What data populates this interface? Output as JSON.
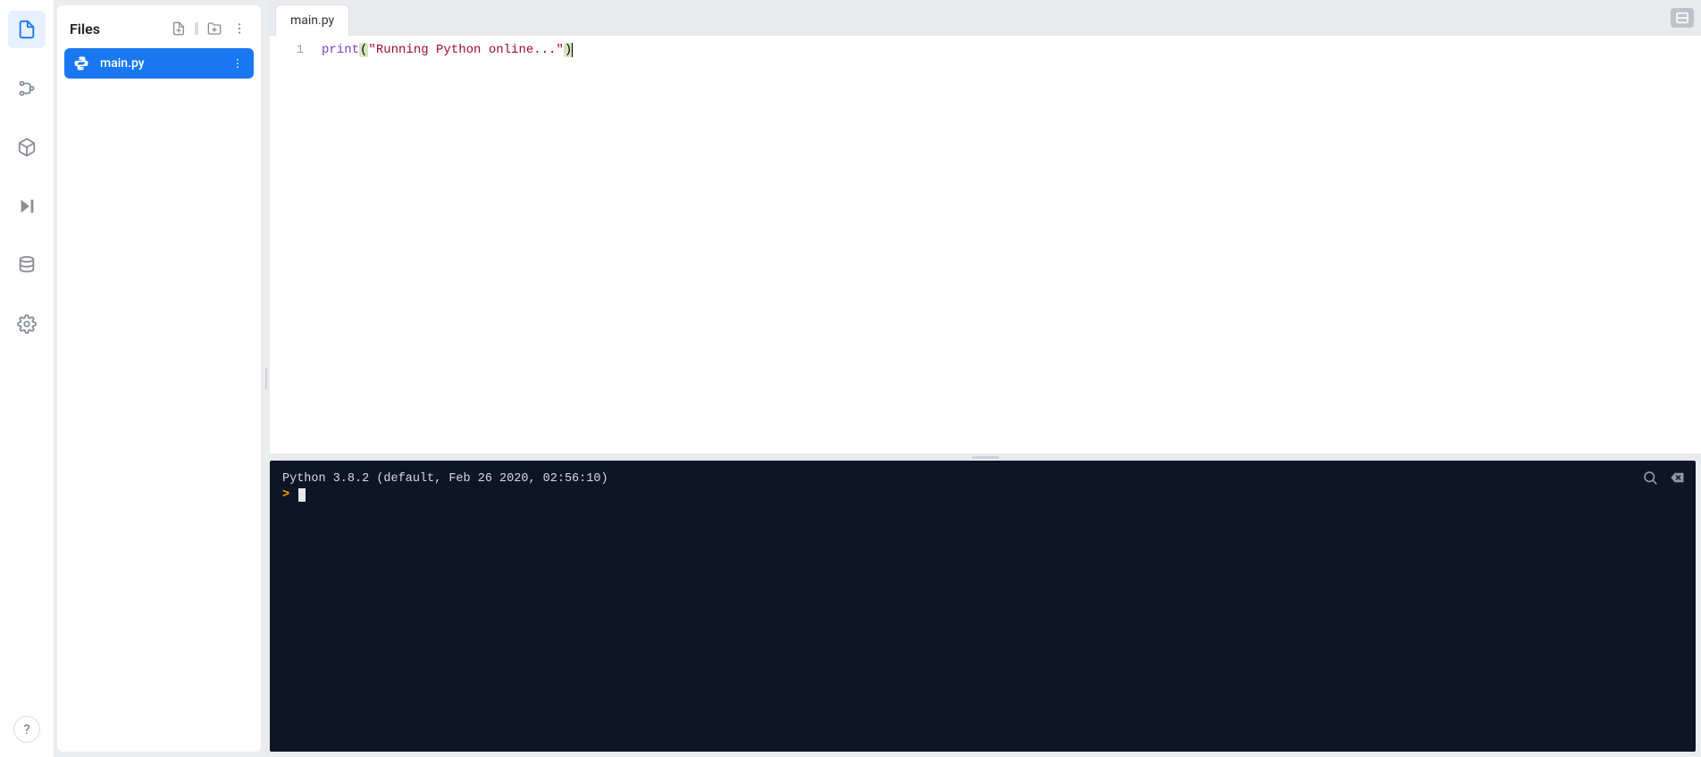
{
  "sidebar": {
    "panel_title": "Files",
    "help_label": "?"
  },
  "files": {
    "items": [
      {
        "name": "main.py"
      }
    ]
  },
  "tabs": {
    "open": [
      {
        "label": "main.py"
      }
    ]
  },
  "editor": {
    "line_numbers": [
      "1"
    ],
    "tokens": {
      "builtin": "print",
      "open_paren": "(",
      "string": "\"Running Python online...\"",
      "close_paren": ")"
    }
  },
  "terminal": {
    "banner": "Python 3.8.2 (default, Feb 26 2020, 02:56:10)",
    "prompt": ">"
  }
}
